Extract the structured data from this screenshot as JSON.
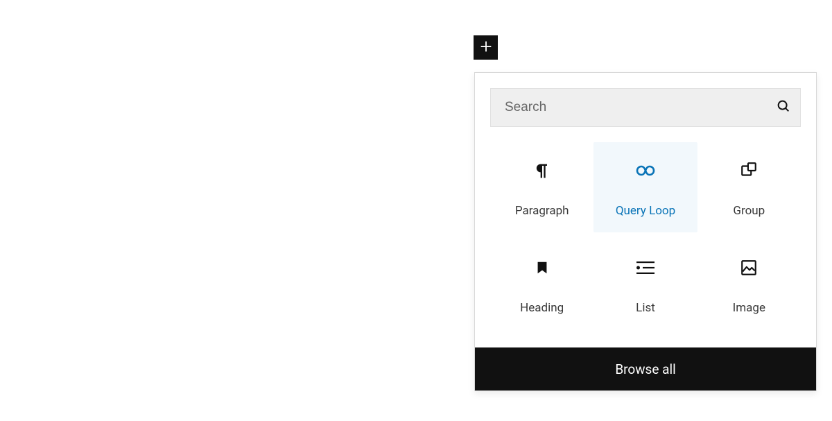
{
  "search": {
    "placeholder": "Search"
  },
  "blocks": {
    "paragraph": {
      "label": "Paragraph"
    },
    "query_loop": {
      "label": "Query Loop",
      "selected": true
    },
    "group": {
      "label": "Group"
    },
    "heading": {
      "label": "Heading"
    },
    "list": {
      "label": "List"
    },
    "image": {
      "label": "Image"
    }
  },
  "browse_all": {
    "label": "Browse all"
  }
}
